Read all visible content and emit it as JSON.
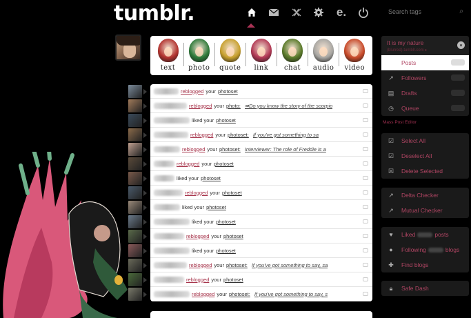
{
  "header": {
    "logo": "tumblr.",
    "nav": [
      {
        "name": "home-icon",
        "glyph": "home"
      },
      {
        "name": "mail-icon",
        "glyph": "✉"
      },
      {
        "name": "explore-icon",
        "glyph": "✕"
      },
      {
        "name": "gear-icon",
        "glyph": "⚙"
      },
      {
        "name": "e-icon",
        "glyph": "e."
      },
      {
        "name": "power-icon",
        "glyph": "⏻"
      }
    ],
    "search_placeholder": "Search tags"
  },
  "post_types": [
    {
      "label": "text",
      "color": "#b2332f"
    },
    {
      "label": "photo",
      "color": "#2f7a3a"
    },
    {
      "label": "quote",
      "color": "#c8a02e"
    },
    {
      "label": "link",
      "color": "#b23a55"
    },
    {
      "label": "chat",
      "color": "#5a7a2a"
    },
    {
      "label": "audio",
      "color": "#a8a6a2"
    },
    {
      "label": "video",
      "color": "#c84a2a"
    }
  ],
  "activity": [
    {
      "verb": "reblogged",
      "word": "your",
      "target": "photoset",
      "quote": ""
    },
    {
      "verb": "reblogged",
      "word": "your",
      "target": "photo:",
      "quote": "➡Do you know the story of the scorpio"
    },
    {
      "verb": "",
      "word": "liked your",
      "target": "photoset",
      "quote": ""
    },
    {
      "verb": "reblogged",
      "word": "your",
      "target": "photoset:",
      "quote": "If you've got something to sa"
    },
    {
      "verb": "reblogged",
      "word": "your",
      "target": "photoset:",
      "quote": "Interviewer: The role of Freddie is a"
    },
    {
      "verb": "reblogged",
      "word": "your",
      "target": "photoset",
      "quote": ""
    },
    {
      "verb": "",
      "word": "liked your",
      "target": "photoset",
      "quote": ""
    },
    {
      "verb": "reblogged",
      "word": "your",
      "target": "photoset",
      "quote": ""
    },
    {
      "verb": "",
      "word": "liked your",
      "target": "photoset",
      "quote": ""
    },
    {
      "verb": "",
      "word": "liked your",
      "target": "photoset",
      "quote": ""
    },
    {
      "verb": "reblogged",
      "word": "your",
      "target": "photoset",
      "quote": ""
    },
    {
      "verb": "",
      "word": "liked your",
      "target": "photoset",
      "quote": ""
    },
    {
      "verb": "reblogged",
      "word": "your",
      "target": "photoset:",
      "quote": "If you've got something to say, sa"
    },
    {
      "verb": "reblogged",
      "word": "your",
      "target": "photoset",
      "quote": ""
    },
    {
      "verb": "reblogged",
      "word": "your",
      "target": "photoset:",
      "quote": "If you've got something to say, s"
    }
  ],
  "sidebar": {
    "blog_title": "It is my nature",
    "blog_url": "(blurred).tumblr.com ▸",
    "main_items": [
      {
        "label": "Posts",
        "icon": "",
        "active": true
      },
      {
        "label": "Followers",
        "icon": "chart-icon"
      },
      {
        "label": "Drafts",
        "icon": "drafts-icon"
      },
      {
        "label": "Queue",
        "icon": "queue-icon"
      }
    ],
    "mass_editor": "Mass Post Editor",
    "edit_items": [
      {
        "label": "Select All",
        "icon": "check-icon"
      },
      {
        "label": "Deselect All",
        "icon": "check-icon"
      },
      {
        "label": "Delete Selected",
        "icon": "delete-icon"
      }
    ],
    "checker_items": [
      {
        "label": "Delta Checker",
        "icon": "chart-icon"
      },
      {
        "label": "Mutual Checker",
        "icon": "chart-icon"
      }
    ],
    "social_items": [
      {
        "label": "Liked",
        "suffix": "posts",
        "icon": "heart-icon"
      },
      {
        "label": "Following",
        "suffix": "blogs",
        "icon": "person-icon"
      },
      {
        "label": "Find blogs",
        "suffix": "",
        "icon": "add-person-icon"
      }
    ],
    "safe_dash": "Safe Dash"
  }
}
